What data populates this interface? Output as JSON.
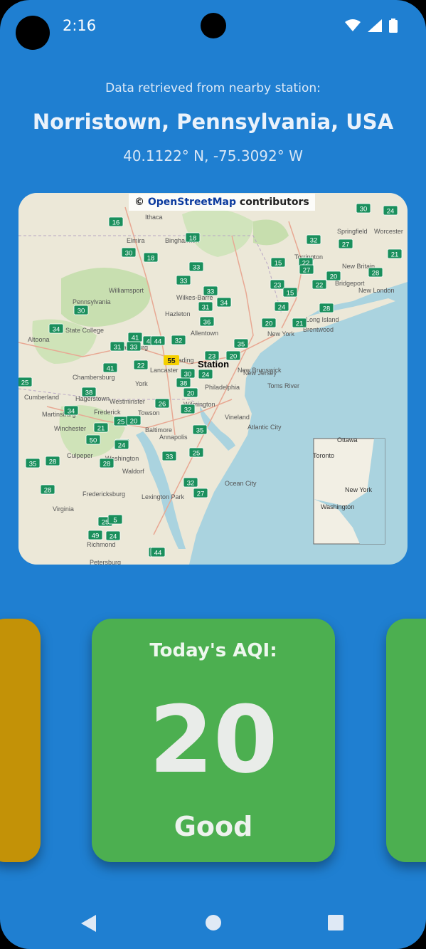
{
  "status_bar": {
    "time": "2:16",
    "icons": [
      "wifi-icon",
      "signal-icon",
      "battery-icon"
    ]
  },
  "header": {
    "subtitle": "Data retrieved from nearby station:",
    "location": "Norristown, Pennsylvania, USA",
    "coordinates": "40.1122° N, -75.3092° W"
  },
  "map": {
    "attribution_prefix": "© ",
    "attribution_link": "OpenStreetMap",
    "attribution_suffix": " contributors",
    "station_label": "Station",
    "station_value": "55",
    "inset_labels": [
      "Ottawa",
      "Toronto",
      "New York",
      "Washington"
    ],
    "place_labels": [
      "Ithaca",
      "Elmira",
      "Binghamton",
      "Springfield",
      "Worcester",
      "Torrington",
      "New Britain",
      "Bridgeport",
      "New London",
      "Long Island",
      "Brentwood",
      "New York",
      "Williamsport",
      "Pennsylvania",
      "State College",
      "Altoona",
      "Harrisburg",
      "Allentown",
      "Wilkes-Barre",
      "Hazleton",
      "Lancaster",
      "Reading",
      "York",
      "Chambersburg",
      "Hagerstown",
      "Cumberland",
      "Frederick",
      "Martinsburg",
      "Winchester",
      "Westminster",
      "Towson",
      "Baltimore",
      "Annapolis",
      "Washington",
      "Waldorf",
      "Culpeper",
      "Fredericksburg",
      "Lexington Park",
      "Philadelphia",
      "New Jersey",
      "New Brunswick",
      "Toms River",
      "Vineland",
      "Atlantic City",
      "Ocean City",
      "Wilmington",
      "Virginia",
      "Richmond",
      "Petersburg"
    ],
    "marker_values": [
      "16",
      "30",
      "18",
      "18",
      "30",
      "24",
      "32",
      "27",
      "22",
      "33",
      "33",
      "15",
      "27",
      "28",
      "21",
      "33",
      "23",
      "15",
      "22",
      "20",
      "30",
      "34",
      "31",
      "34",
      "28",
      "24",
      "21",
      "20",
      "36",
      "25",
      "41",
      "33",
      "31",
      "43",
      "32",
      "44",
      "35",
      "23",
      "20",
      "22",
      "41",
      "30",
      "24",
      "26",
      "25",
      "38",
      "20",
      "38",
      "34",
      "25",
      "20",
      "32",
      "21",
      "50",
      "15",
      "24",
      "35",
      "35",
      "28",
      "28",
      "25",
      "33",
      "32",
      "28",
      "27",
      "25",
      "5",
      "49",
      "24",
      "24",
      "44",
      "23",
      "21",
      "21"
    ]
  },
  "aqi": {
    "title": "Today's AQI:",
    "value": "20",
    "status": "Good"
  },
  "colors": {
    "background": "#1f7fd1",
    "good": "#4caf50",
    "moderate": "#c39207",
    "marker_green": "#1a8f5c",
    "marker_yellow": "#f5d000"
  },
  "nav": {
    "back_icon": "back-triangle-icon",
    "home_icon": "home-circle-icon",
    "recents_icon": "recents-square-icon"
  }
}
